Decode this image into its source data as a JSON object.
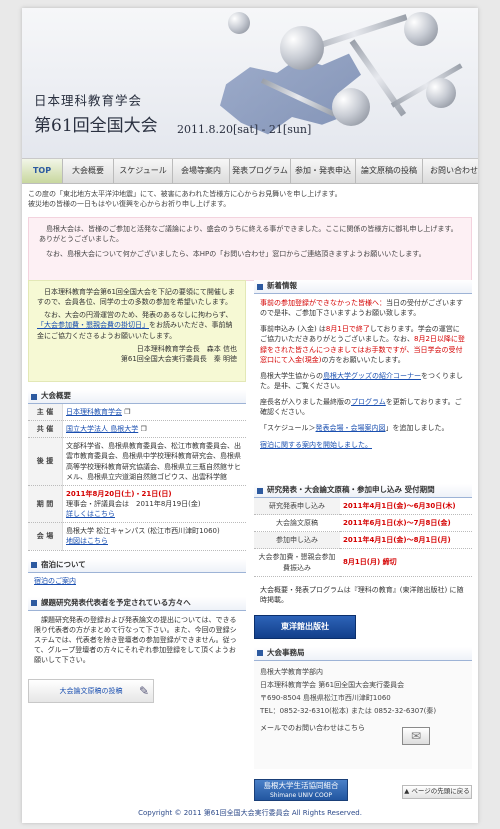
{
  "header": {
    "org": "日本理科教育学会",
    "title": "第61回全国大会",
    "date": "2011.8.20[sat] - 21[sun]"
  },
  "nav": [
    "TOP",
    "大会概要",
    "スケジュール",
    "会場等案内",
    "発表プログラム",
    "参加・発表申込",
    "論文原稿の投稿",
    "お問い合わせ"
  ],
  "notice": {
    "line1": "この度の「東北地方太平洋沖地震」にて、被害にあわれた皆様方に心からお見舞いを申し上げます。",
    "line2": "被災地の皆様の一日もはやい復興を心からお祈り申し上げます。"
  },
  "thanks": {
    "p1": "島根大会は、皆様のご参加と活発なご議論により、盛会のうちに終える事ができました。ここに関係の皆様方に御礼申し上げます。ありがとうございました。",
    "p2": "なお、島根大会について何かございましたら、本HPの「お問い合わせ」窓口からご連絡頂きますようお願いいたします。"
  },
  "greeting": {
    "p1": "日本理科教育学会第61回全国大会を下記の要領にて開催しますので、会員各位、同学の士の多数の参加を希望いたします。",
    "p2_before": "なお、大会の円滑運営のため、発表のあるなしに拘わらず、",
    "p2_link": "「大会参加費・懇親会費の掛切日」",
    "p2_after": "をお読みいただき、事前納金にご協力くださるようお願いいたします。",
    "sig1": "日本理科教育学会長　森本 信也",
    "sig2": "第61回全国大会実行委員長　秦 明徳"
  },
  "overview": {
    "heading": "大会概要",
    "organizer_key": "主 催",
    "organizer": "日本理科教育学会",
    "cohost_key": "共 催",
    "cohost": "国立大学法人 島根大学",
    "support_key": "後 援",
    "support": "文部科学省、島根県教育委員会、松江市教育委員会、出雲市教育委員会、島根県中学校理科教育研究会、島根県高等学校理科教育研究協議会、島根県立三瓶自然館サヒメル、島根県立宍道湖自然館ゴビウス、出雲科学館",
    "period_key": "期 間",
    "period_main": "2011年8月20日(土)・21日(日)",
    "period_sub": "理事会・評議員会は　2011年8月19日(金)",
    "period_link": "詳しくはこちら",
    "venue_key": "会 場",
    "venue": "島根大学 松江キャンパス (松江市西川津町1060)",
    "venue_link": "地図はこちら"
  },
  "lodging": {
    "heading": "宿泊について",
    "link": "宿泊のご案内"
  },
  "presenters": {
    "heading": "課題研究発表代表者を予定されている方々へ",
    "text": "課題研究発表の登録および発表論文の提出については、できる限り代表者の方がまとめて行なって下さい。また、今回の登録システムでは、代表者を除き登壇者の参加登録ができません。従って、グループ登壇者の方々にそれぞれ参加登録をして頂くようお願いして下さい。"
  },
  "submit_button": "大会論文原稿の投稿",
  "news": {
    "heading": "新着情報",
    "item1_red": "事前の参加登録ができなかった皆様へ：",
    "item1": "当日の受付がございますので是非、ご参加下さいますようお願い致します。",
    "item2_a": "事前申込み (入金) は",
    "item2_red1": "8月1日で終了",
    "item2_b": "しております。学会の運営にご協力いただきありがとうございました。なお、",
    "item2_red2": "8月2日以降に登録をされた皆さんにつきましてはお手数ですが、当日学会の受付窓口にて入金(現金)",
    "item2_c": "の方をお願いいたします。",
    "item3_a": "島根大学生協からの",
    "item3_link": "島根大学グッズの紹介コーナー",
    "item3_b": "をつくりました。是非、ご覧ください。",
    "item4_a": "座長名が入りました最終版の",
    "item4_link": "プログラム",
    "item4_b": "を更新しております。ご確認ください。",
    "item5_a": "「スケジュール＞",
    "item5_link": "発表会場・会場案内図",
    "item5_b": "」を追加しました。",
    "item6_link": "宿泊に関する案内を開始しました。"
  },
  "schedule": {
    "heading": "研究発表・大会論文原稿・参加申し込み 受付期間",
    "rows": [
      {
        "key": "研究発表申し込み",
        "val": "2011年4月1日(金)〜6月30日(木)"
      },
      {
        "key": "大会論文原稿",
        "val": "2011年6月1日(水)〜7月8日(金)"
      },
      {
        "key": "参加申し込み",
        "val": "2011年4月1日(金)〜8月1日(月)"
      },
      {
        "key": "大会参加費・懇親会参加費振込み",
        "val": "8月1日(月) 締切"
      }
    ],
    "note": "大会概要・発表プログラムは『理科の教育』(東洋館出版社) に随時掲載。"
  },
  "ad_publisher": "東洋館出版社",
  "office": {
    "heading": "大会事務局",
    "line1": "島根大学教育学部内",
    "line2": "日本理科教育学会 第61回全国大会実行委員会",
    "address": "〒690-8504 島根県松江市西川津町1060",
    "tel": "TEL：0852-32-6310(松本) または 0852-32-6307(秦)",
    "mail": "メールでのお問い合わせはこちら"
  },
  "coop": {
    "line1": "島根大学生活協同組合",
    "line2": "Shimane UNIV COOP"
  },
  "back_to_top": "▲ ページの先頭に戻る",
  "footer": "Copyright © 2011 第61回全国大会実行委員会 All Rights Reserved."
}
